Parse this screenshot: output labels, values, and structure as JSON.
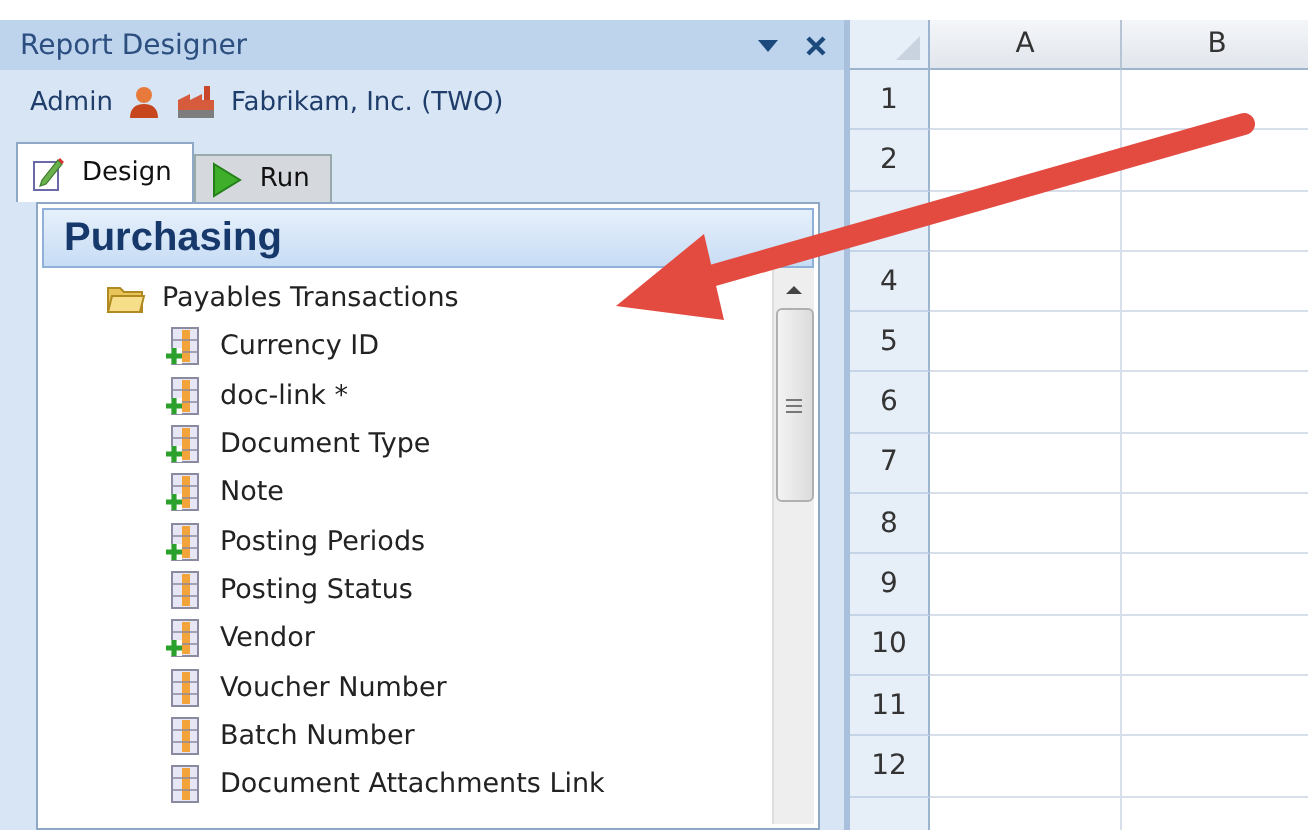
{
  "panel": {
    "title": "Report Designer",
    "user": "Admin",
    "company": "Fabrikam, Inc. (TWO)",
    "tabs": [
      {
        "label": "Design",
        "kind": "design",
        "selected": true
      },
      {
        "label": "Run",
        "kind": "run",
        "selected": false
      }
    ],
    "heading": "Purchasing",
    "tree": {
      "label": "Payables Transactions",
      "expanded": true,
      "children": [
        {
          "label": "Currency ID",
          "kind": "calculated"
        },
        {
          "label": "doc-link *",
          "kind": "calculated"
        },
        {
          "label": "Document Type",
          "kind": "calculated"
        },
        {
          "label": "Note",
          "kind": "calculated"
        },
        {
          "label": "Posting Periods",
          "kind": "calculated"
        },
        {
          "label": "Posting Status",
          "kind": "field"
        },
        {
          "label": "Vendor",
          "kind": "calculated"
        },
        {
          "label": "Voucher Number",
          "kind": "field"
        },
        {
          "label": "Batch Number",
          "kind": "field"
        },
        {
          "label": "Document Attachments Link",
          "kind": "field"
        }
      ]
    }
  },
  "sheet": {
    "columns": [
      "A",
      "B"
    ],
    "rows": [
      "1",
      "2",
      null,
      "4",
      "5",
      "6",
      "7",
      "8",
      "9",
      "10",
      "11",
      "12",
      null
    ]
  }
}
